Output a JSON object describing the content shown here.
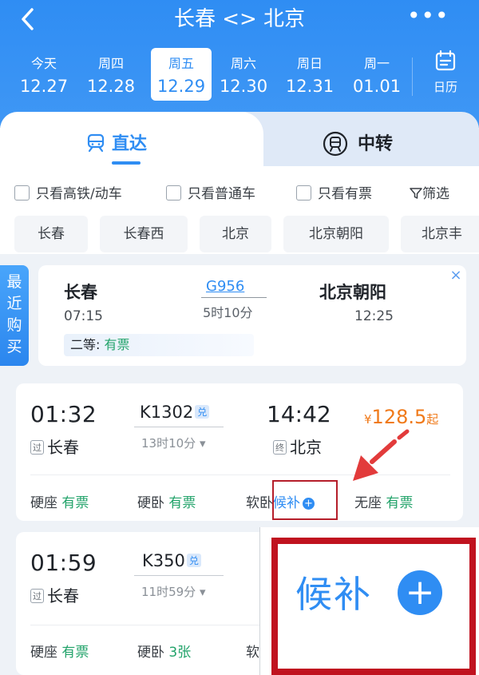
{
  "header": {
    "title": "长春 <> 北京",
    "more_label": "•••"
  },
  "dates": [
    {
      "weekday": "今天",
      "date": "12.27"
    },
    {
      "weekday": "周四",
      "date": "12.28"
    },
    {
      "weekday": "周五",
      "date": "12.29",
      "selected": true
    },
    {
      "weekday": "周六",
      "date": "12.30"
    },
    {
      "weekday": "周日",
      "date": "12.31"
    },
    {
      "weekday": "周一",
      "date": "01.01"
    }
  ],
  "calendar": {
    "label": "日历"
  },
  "tabs": {
    "direct": "直达",
    "transfer": "中转"
  },
  "filters": {
    "high_speed": "只看高铁/动车",
    "normal": "只看普通车",
    "available": "只看有票",
    "screen": "筛选"
  },
  "stations": [
    "长春",
    "长春西",
    "北京",
    "北京朝阳",
    "北京丰"
  ],
  "recent": {
    "tag": "最近购买",
    "from_station": "长春",
    "from_time": "07:15",
    "train_no": "G956",
    "duration": "5时10分",
    "to_station": "北京朝阳",
    "to_time": "12:25",
    "seat_class": "二等:",
    "seat_status": "有票",
    "close": "×"
  },
  "trains": [
    {
      "dep_time": "01:32",
      "dep_tag": "过",
      "dep_station": "长春",
      "train_no": "K1302",
      "dui": "兑",
      "duration": "13时10分 ▾",
      "arr_time": "14:42",
      "arr_tag": "终",
      "arr_station": "北京",
      "price_currency": "¥",
      "price": "128.5",
      "price_suffix": "起",
      "seats": [
        {
          "name": "硬座",
          "status": "有票"
        },
        {
          "name": "硬卧",
          "status": "有票"
        },
        {
          "name": "软卧",
          "status": "候补"
        },
        {
          "name": "无座",
          "status": "有票"
        }
      ]
    },
    {
      "dep_time": "01:59",
      "dep_tag": "过",
      "dep_station": "长春",
      "train_no": "K350",
      "dui": "兑",
      "duration": "11时59分 ▾",
      "seats": [
        {
          "name": "硬座",
          "status": "有票"
        },
        {
          "name": "硬卧",
          "status": "3张"
        },
        {
          "name": "软",
          "status": ""
        }
      ]
    }
  ],
  "zoom": {
    "text": "候补",
    "plus": "+"
  },
  "colors": {
    "primary": "#2f8df3",
    "available": "#22a36a",
    "price": "#f07a1a",
    "annotation": "#c0121f"
  }
}
